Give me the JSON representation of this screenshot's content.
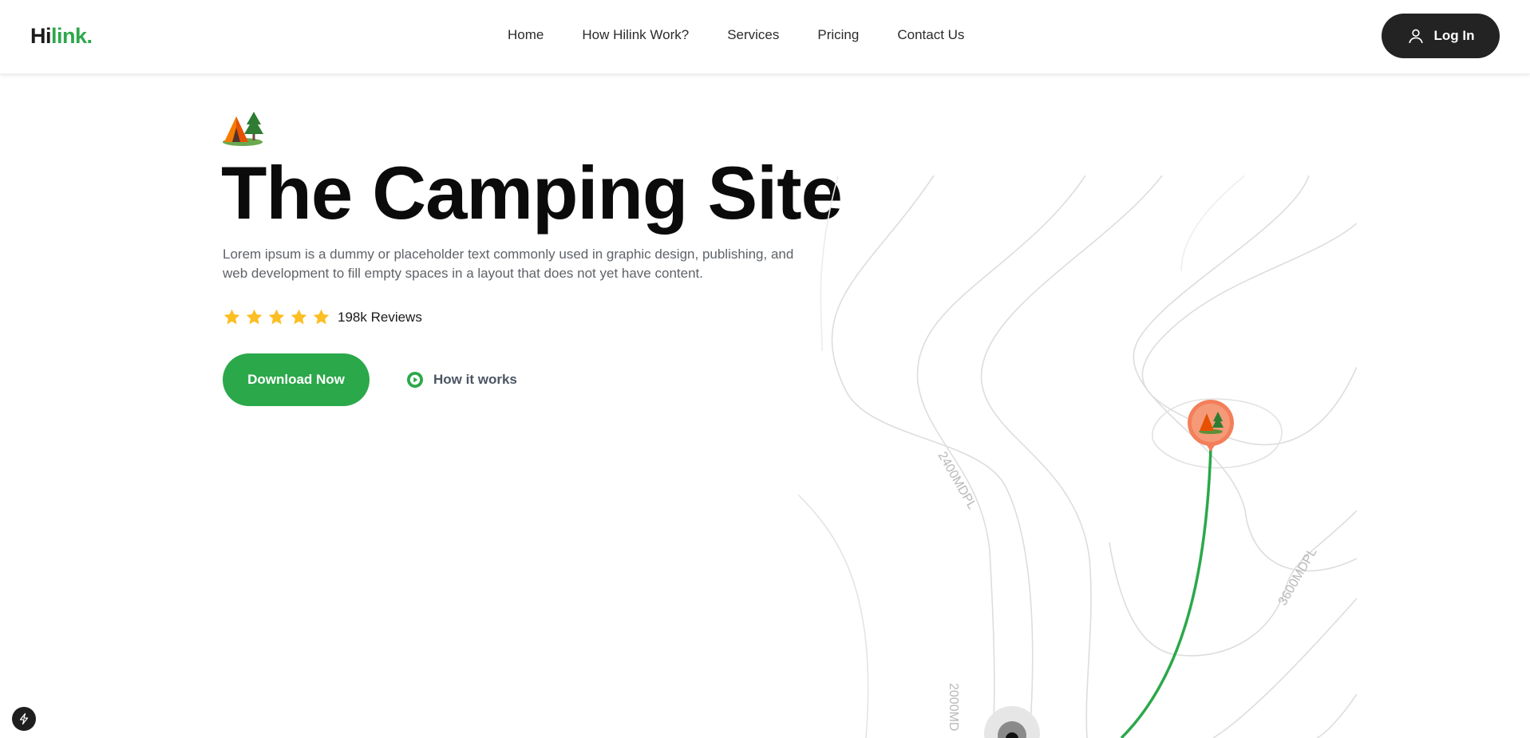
{
  "header": {
    "logo_part1": "Hi",
    "logo_part2": "link.",
    "nav": [
      "Home",
      "How Hilink Work?",
      "Services",
      "Pricing",
      "Contact Us"
    ],
    "login_label": "Log In"
  },
  "hero": {
    "icon": "camping-icon",
    "title": "The Camping Site",
    "description": "Lorem ipsum is a dummy or placeholder text commonly used in graphic design, publishing, and web development to fill empty spaces in a layout that does not yet have content.",
    "stars": 5,
    "reviews": "198k Reviews",
    "primary_button": "Download Now",
    "secondary_button": "How it works"
  },
  "map": {
    "labels": [
      "2400MDPL",
      "3600MDPL",
      "2000MD"
    ],
    "route_color": "#2ba84a",
    "pin_color": "#f37f5a"
  },
  "colors": {
    "accent": "#2ba84a",
    "dark_button": "#222322",
    "star": "#fbbf24"
  }
}
